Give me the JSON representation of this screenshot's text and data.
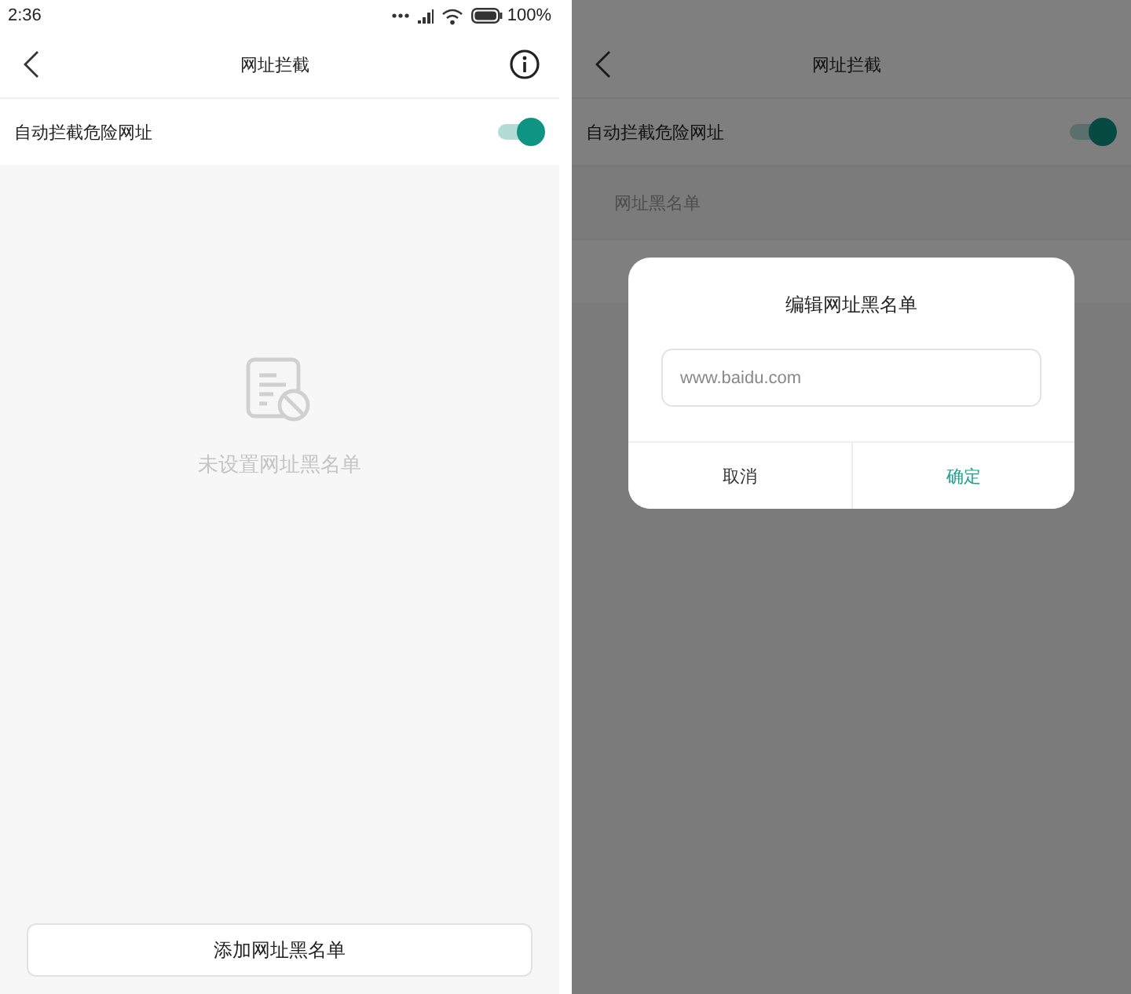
{
  "left_screen": {
    "status_bar": {
      "time": "2:36",
      "battery": "100%"
    },
    "header": {
      "title": "网址拦截"
    },
    "toggle_row": {
      "label": "自动拦截危险网址",
      "on": true
    },
    "empty_state": {
      "message": "未设置网址黑名单"
    },
    "add_button": {
      "label": "添加网址黑名单"
    }
  },
  "right_screen": {
    "header": {
      "title": "网址拦截"
    },
    "toggle_row": {
      "label": "自动拦截危险网址",
      "on": true
    },
    "section_label": "网址黑名单",
    "dialog": {
      "title": "编辑网址黑名单",
      "placeholder": "www.baidu.com",
      "buttons": [
        {
          "label": "取消",
          "kind": "cancel"
        },
        {
          "label": "确定",
          "kind": "confirm"
        }
      ]
    }
  }
}
